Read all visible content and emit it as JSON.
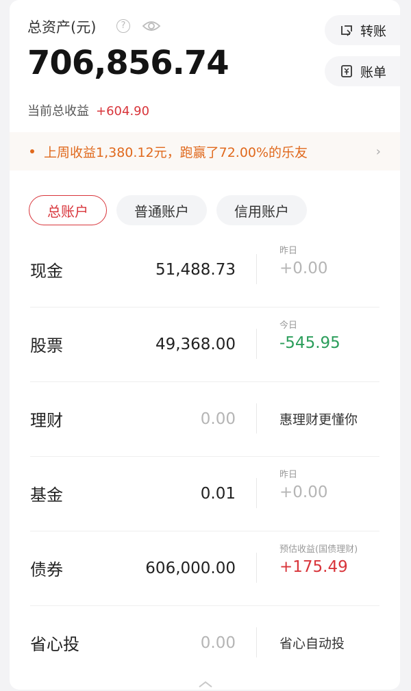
{
  "header": {
    "label": "总资产(元)",
    "total": "706,856.74",
    "profit_label": "当前总收益",
    "profit_value": "+604.90",
    "help_glyph": "?"
  },
  "actions": {
    "transfer": "转账",
    "bill": "账单"
  },
  "notice": {
    "text": "上周收益1,380.12元，跑赢了72.00%的乐友",
    "chevron": "›"
  },
  "tabs": [
    "总账户",
    "普通账户",
    "信用账户"
  ],
  "accounts": [
    {
      "name": "现金",
      "amount": "51,488.73",
      "sub": "昨日",
      "change": "+0.00"
    },
    {
      "name": "股票",
      "amount": "49,368.00",
      "sub": "今日",
      "change": "-545.95"
    },
    {
      "name": "理财",
      "amount": "0.00",
      "note": "惠理财更懂你"
    },
    {
      "name": "基金",
      "amount": "0.01",
      "sub": "昨日",
      "change": "+0.00"
    },
    {
      "name": "债券",
      "amount": "606,000.00",
      "sub": "预估收益(国债理财)",
      "change": "+175.49"
    },
    {
      "name": "省心投",
      "amount": "0.00",
      "note": "省心自动投"
    }
  ],
  "colors": {
    "red": "#d8343a",
    "green": "#2a9d5a",
    "orange": "#e0691d",
    "muted": "#b5b5b5"
  }
}
